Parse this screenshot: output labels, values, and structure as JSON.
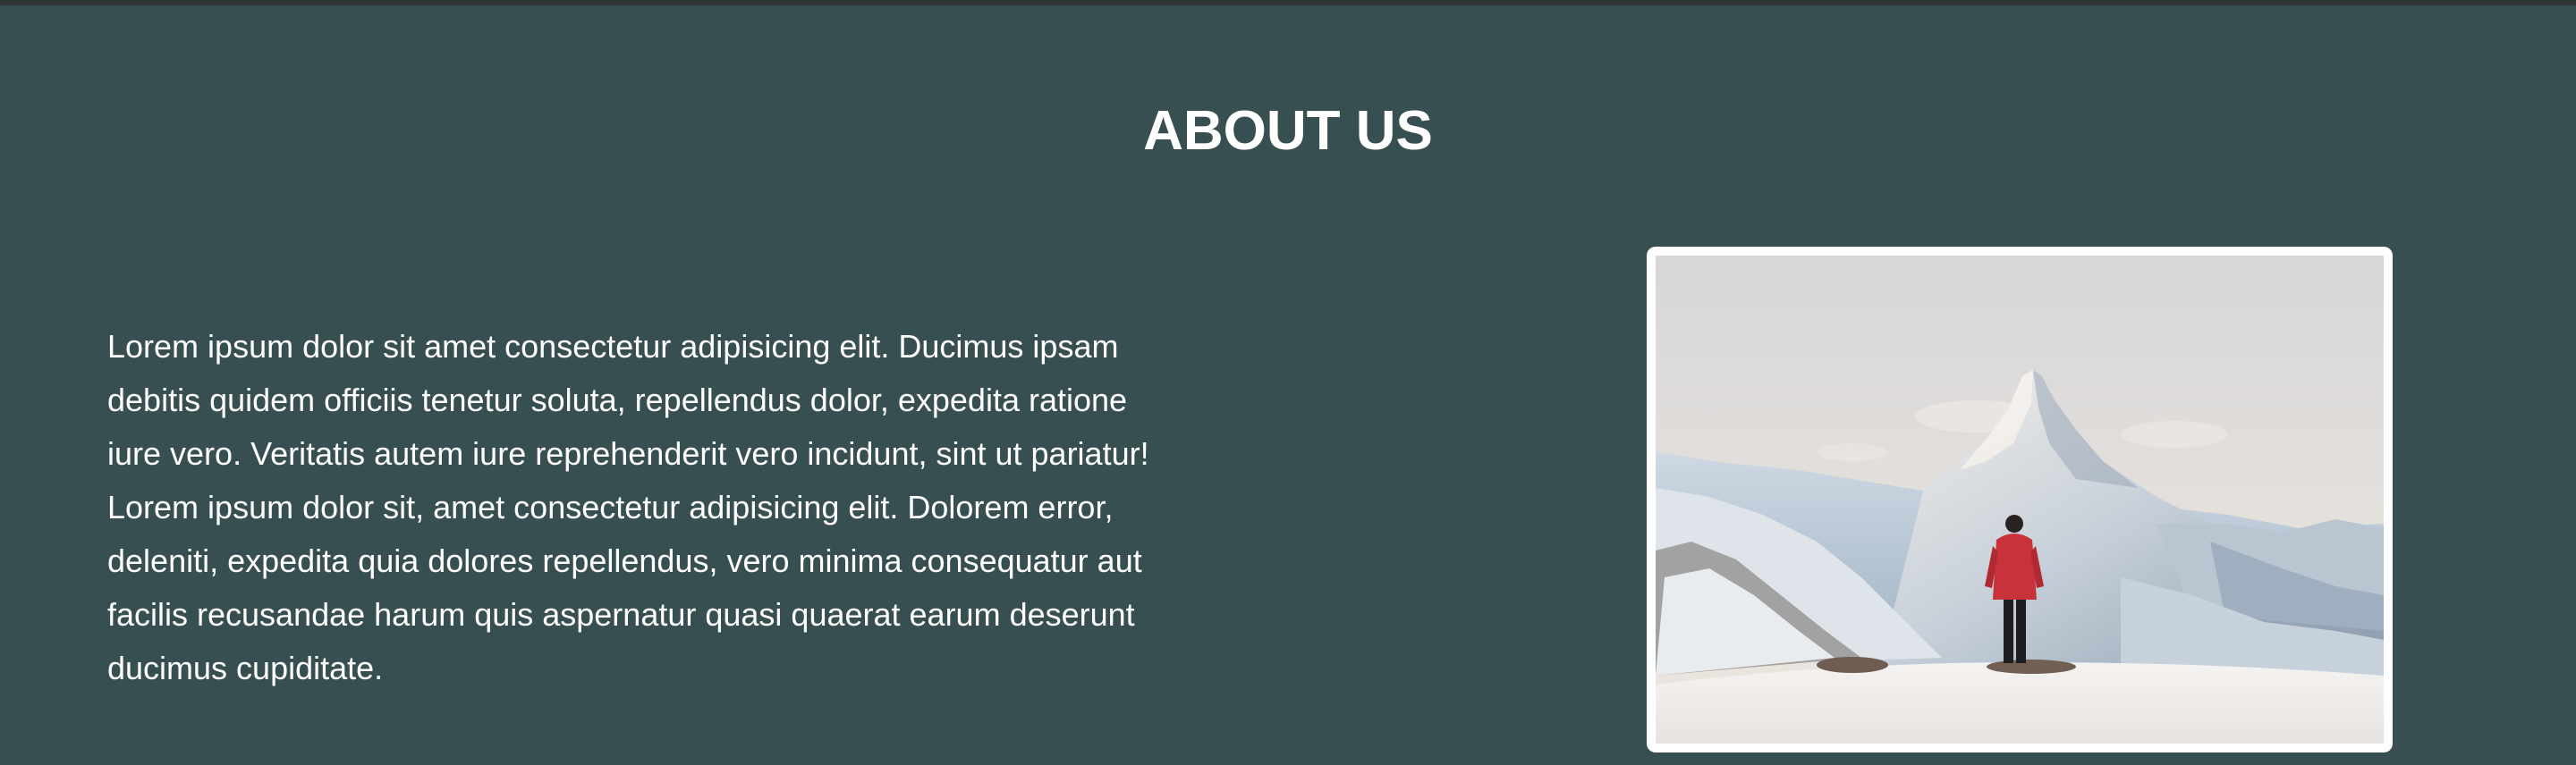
{
  "about": {
    "title": "ABOUT US",
    "body": "Lorem ipsum dolor sit amet consectetur adipisicing elit. Ducimus ipsam debitis quidem officiis tenetur soluta, repellendus dolor, expedita ratione iure vero. Veritatis autem iure reprehenderit vero incidunt, sint ut pariatur! Lorem ipsum dolor sit, amet consectetur adipisicing elit. Dolorem error, deleniti, expedita quia dolores repellendus, vero minima consequatur aut facilis recusandae harum quis aspernatur quasi quaerat earum deserunt ducimus cupiditate."
  },
  "colors": {
    "background": "#374f51",
    "top_strip": "#2f3434",
    "text": "#ffffff",
    "frame": "#ffffff"
  },
  "image": {
    "subject": "hiker-in-red-jacket-facing-snowy-mountain-peak"
  }
}
